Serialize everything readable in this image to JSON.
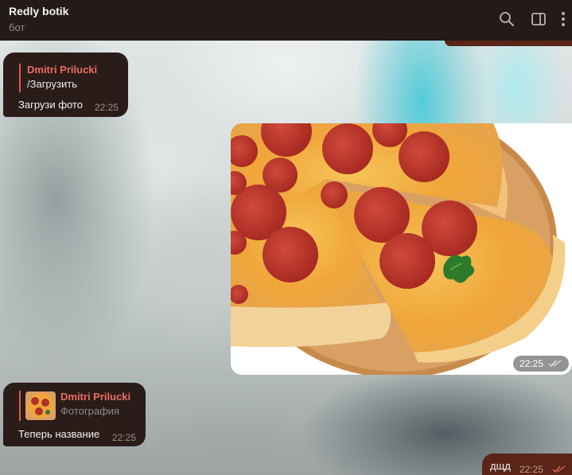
{
  "header": {
    "title": "Redly botik",
    "subtitle": "бот",
    "icons": [
      "search-icon",
      "sidebar-toggle-icon",
      "more-vertical-icon"
    ]
  },
  "messages": [
    {
      "reply_name": "Dmitri Prilucki",
      "reply_text": "/Загрузить",
      "text": "Загрузи фото",
      "time": "22:25"
    },
    {
      "type": "photo",
      "time": "22:25",
      "status": "read"
    },
    {
      "reply_name": "Dmitri Prilucki",
      "reply_text": "Фотография",
      "text": "Теперь название",
      "time": "22:25"
    },
    {
      "text": "дщд",
      "time": "22:25",
      "status": "read"
    }
  ],
  "colors": {
    "header_bg": "#241a18",
    "bubble_in": "#2a1c19",
    "bubble_out": "#5a2418",
    "reply_accent": "#ea6d62"
  }
}
